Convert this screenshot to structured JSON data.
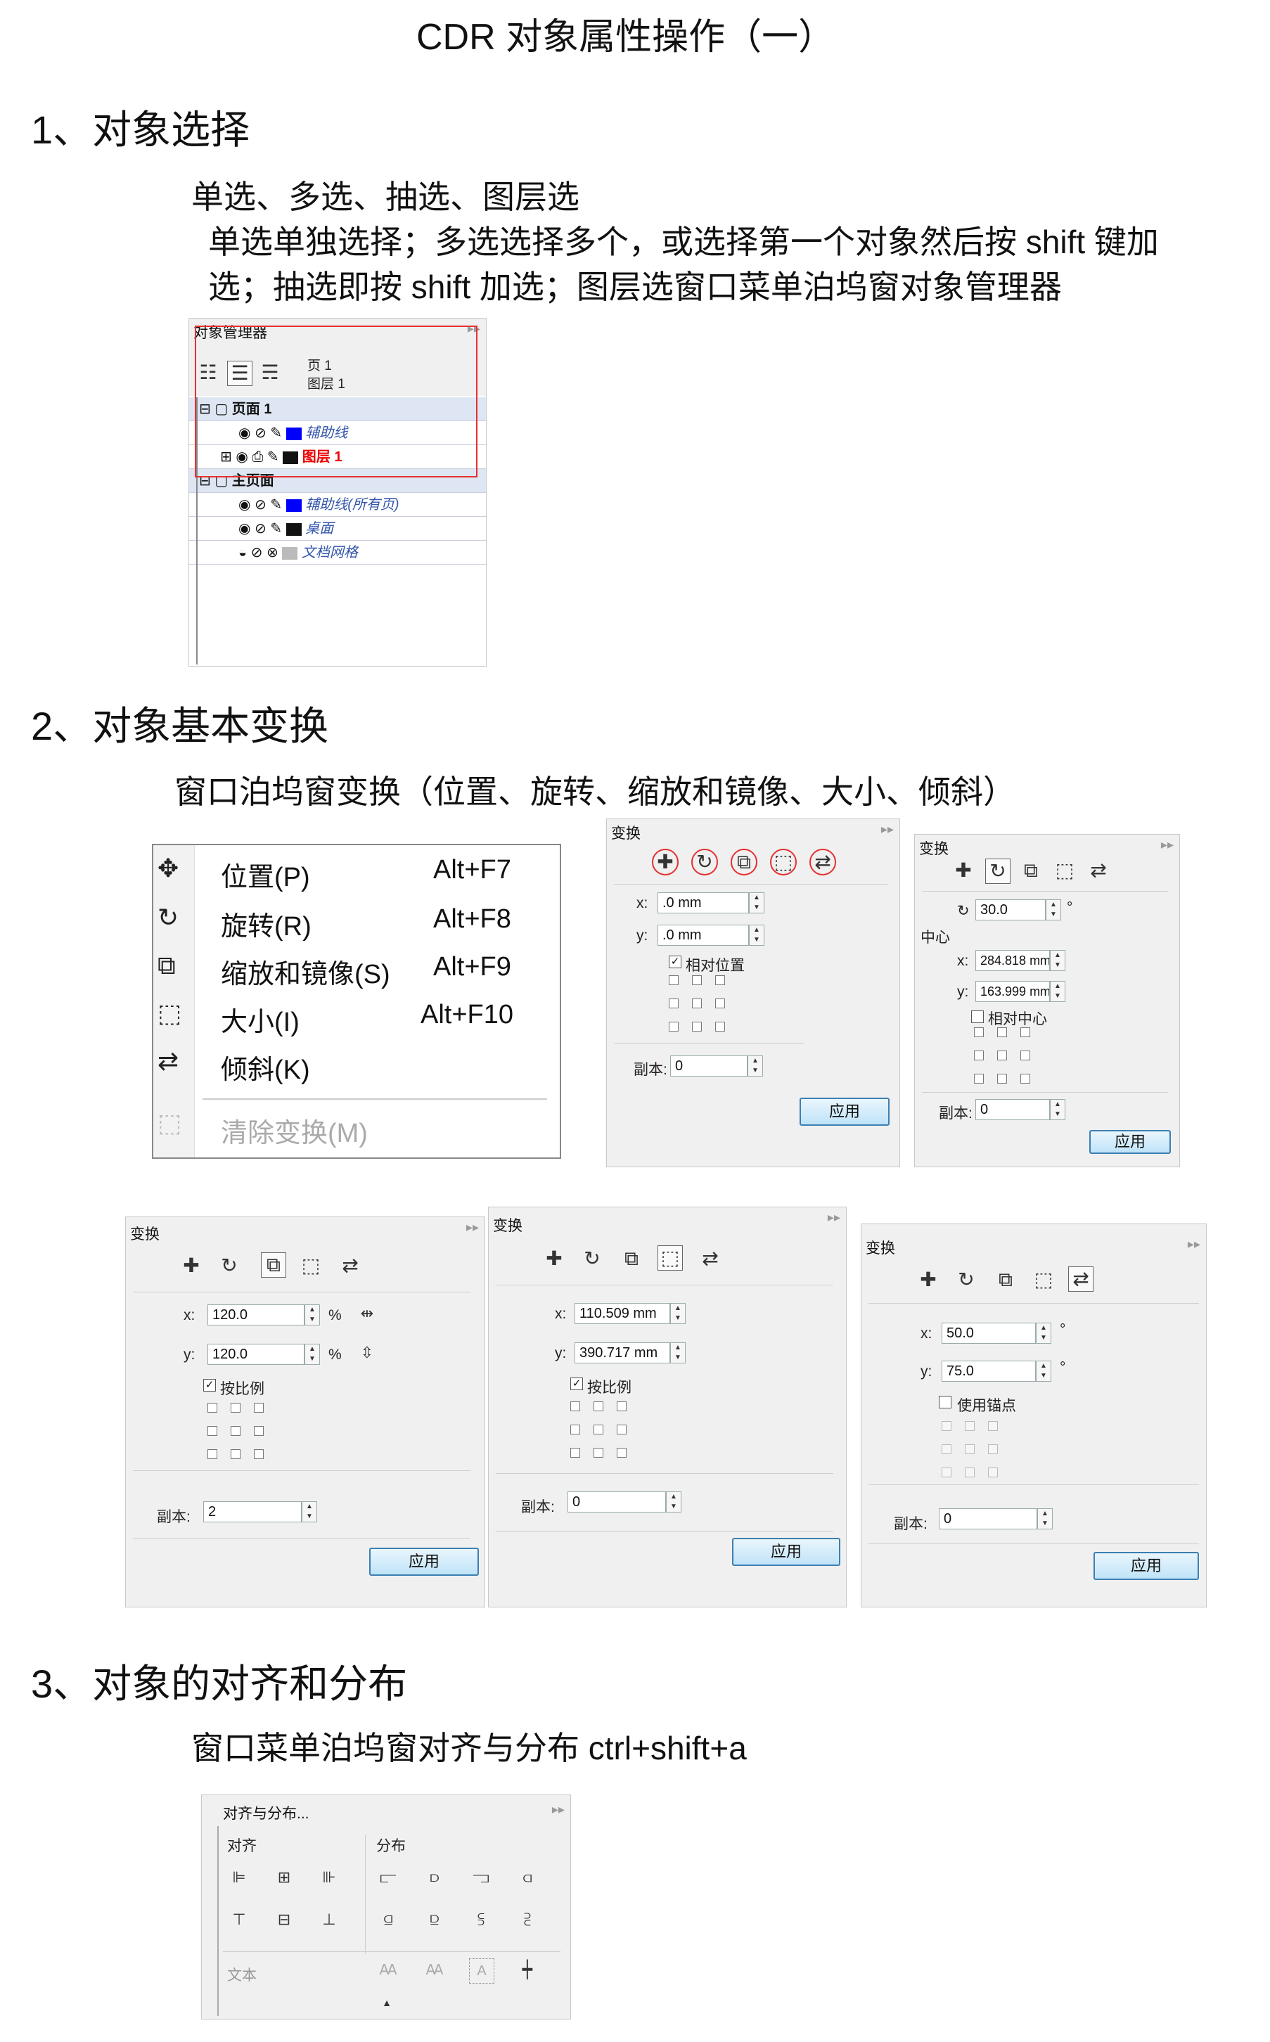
{
  "title": "CDR 对象属性操作（一）",
  "section1": {
    "heading": "1、对象选择",
    "line1": "单选、多选、抽选、图层选",
    "line2": "单选单独选择；多选选择多个，或选择第一个对象然后按 shift 键加",
    "line3": "选；抽选即按 shift 加选；图层选窗口菜单泊坞窗对象管理器",
    "panel": {
      "title": "对象管理器",
      "page_label": "页 1",
      "layer_label": "图层 1",
      "rows": [
        {
          "text": "页面 1",
          "type": "header"
        },
        {
          "text": "辅助线",
          "type": "item",
          "color": "#0000ff"
        },
        {
          "text": "图层 1",
          "type": "item-red",
          "color": "#111111"
        },
        {
          "text": "主页面",
          "type": "header"
        },
        {
          "text": "辅助线(所有页)",
          "type": "item",
          "color": "#0000ff"
        },
        {
          "text": "桌面",
          "type": "item",
          "color": "#111111"
        },
        {
          "text": "文档网格",
          "type": "item",
          "color": "#bbbbbb"
        }
      ]
    }
  },
  "section2": {
    "heading": "2、对象基本变换",
    "line1": "窗口泊坞窗变换（位置、旋转、缩放和镜像、大小、倾斜）",
    "menu": {
      "items": [
        {
          "label": "位置(P)",
          "shortcut": "Alt+F7",
          "icon": "position-icon"
        },
        {
          "label": "旋转(R)",
          "shortcut": "Alt+F8",
          "icon": "rotate-icon"
        },
        {
          "label": "缩放和镜像(S)",
          "shortcut": "Alt+F9",
          "icon": "scale-icon"
        },
        {
          "label": "大小(I)",
          "shortcut": "Alt+F10",
          "icon": "size-icon"
        },
        {
          "label": "倾斜(K)",
          "shortcut": "",
          "icon": "skew-icon"
        }
      ],
      "clear": "清除变换(M)"
    },
    "position_panel": {
      "title": "变换",
      "x_label": "x:",
      "x": ".0 mm",
      "y_label": "y:",
      "y": ".0 mm",
      "check": "相对位置",
      "copies_label": "副本:",
      "copies": "0",
      "apply": "应用"
    },
    "rotate_panel": {
      "title": "变换",
      "angle": "30.0",
      "deg": "°",
      "center": "中心",
      "x_label": "x:",
      "x": "284.818 mm",
      "y_label": "y:",
      "y": "163.999 mm",
      "check": "相对中心",
      "copies_label": "副本:",
      "copies": "0",
      "apply": "应用"
    },
    "scale_panel": {
      "title": "变换",
      "x_label": "x:",
      "x": "120.0",
      "y_label": "y:",
      "y": "120.0",
      "pct": "%",
      "check": "按比例",
      "copies_label": "副本:",
      "copies": "2",
      "apply": "应用"
    },
    "size_panel": {
      "title": "变换",
      "x_label": "x:",
      "x": "110.509 mm",
      "y_label": "y:",
      "y": "390.717 mm",
      "check": "按比例",
      "copies_label": "副本:",
      "copies": "0",
      "apply": "应用"
    },
    "skew_panel": {
      "title": "变换",
      "x_label": "x:",
      "x": "50.0",
      "y_label": "y:",
      "y": "75.0",
      "deg": "°",
      "check": "使用锚点",
      "copies_label": "副本:",
      "copies": "0",
      "apply": "应用"
    }
  },
  "section3": {
    "heading": "3、对象的对齐和分布",
    "line1": "窗口菜单泊坞窗对齐与分布 ctrl+shift+a",
    "panel": {
      "title": "对齐与分布...",
      "align": "对齐",
      "distribute": "分布",
      "text": "文本"
    }
  }
}
